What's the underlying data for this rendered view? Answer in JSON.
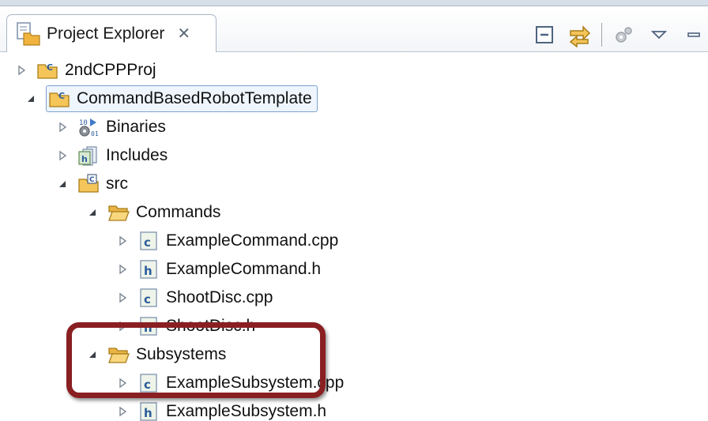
{
  "view": {
    "tab_title": "Project Explorer",
    "tab_close": "✕",
    "tab_icon": "project-explorer-icon"
  },
  "toolbar": {
    "buttons": [
      {
        "name": "collapse-all-icon"
      },
      {
        "name": "link-with-editor-icon"
      },
      {
        "name": "build-gears-icon"
      },
      {
        "name": "view-menu-icon"
      },
      {
        "name": "minimize-icon"
      }
    ]
  },
  "tree": {
    "items": [
      {
        "label": "2ndCPPProj",
        "icon": "cpp-project-icon",
        "expanded": false
      },
      {
        "label": "CommandBasedRobotTemplate",
        "icon": "cpp-project-icon",
        "expanded": true,
        "selected": true
      },
      {
        "label": "Binaries",
        "icon": "binaries-icon",
        "expanded": false
      },
      {
        "label": "Includes",
        "icon": "includes-icon",
        "expanded": false
      },
      {
        "label": "src",
        "icon": "source-folder-icon",
        "expanded": true
      },
      {
        "label": "Commands",
        "icon": "folder-icon",
        "expanded": true
      },
      {
        "label": "ExampleCommand.cpp",
        "icon": "cpp-file-icon",
        "expanded": false
      },
      {
        "label": "ExampleCommand.h",
        "icon": "header-file-icon",
        "expanded": false
      },
      {
        "label": "ShootDisc.cpp",
        "icon": "cpp-file-icon",
        "expanded": false
      },
      {
        "label": "ShootDisc.h",
        "icon": "header-file-icon",
        "expanded": false
      },
      {
        "label": "Subsystems",
        "icon": "folder-icon",
        "expanded": true
      },
      {
        "label": "ExampleSubsystem.cpp",
        "icon": "cpp-file-icon",
        "expanded": false
      },
      {
        "label": "ExampleSubsystem.h",
        "icon": "header-file-icon",
        "expanded": false
      }
    ]
  },
  "colors": {
    "highlight_border": "#8a1f22",
    "selection_fill": "#eef5fd",
    "selection_border": "#7da2ce"
  }
}
